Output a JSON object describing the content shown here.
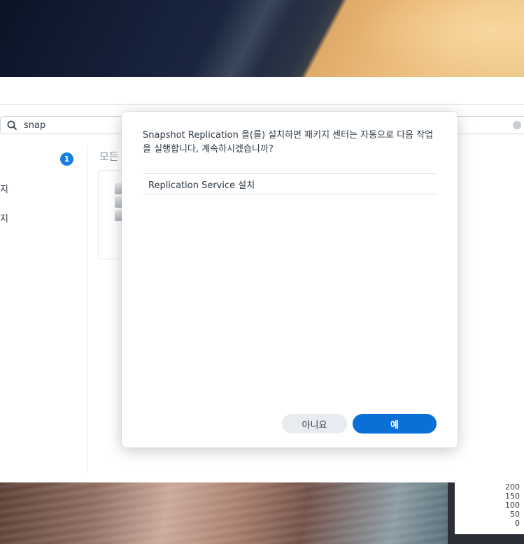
{
  "search": {
    "value": "snap"
  },
  "sidebar": {
    "badge_count": "1",
    "items": [
      {
        "label": "지"
      },
      {
        "label": "지"
      }
    ]
  },
  "main": {
    "section_title": "모든"
  },
  "dialog": {
    "message": "Snapshot Replication 을(를) 설치하면 패키지 센터는 자동으로 다음 작업을 실행합니다, 계속하시겠습니까?",
    "tasks": [
      {
        "label": "Replication Service 설치"
      }
    ],
    "no_label": "아니요",
    "yes_label": "예"
  },
  "widget": {
    "axis_ticks": [
      "200",
      "150",
      "100",
      "50",
      "0"
    ]
  },
  "colors": {
    "primary": "#0a6fd6",
    "badge": "#1a7fe0"
  }
}
